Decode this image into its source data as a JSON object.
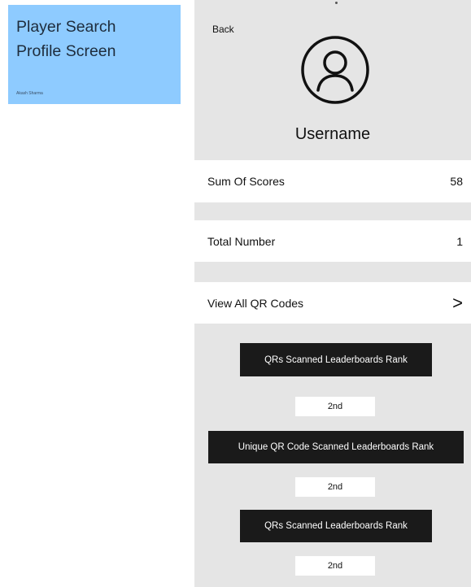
{
  "note": {
    "title": "Player Search\nProfile Screen",
    "author": "Akash Sharma"
  },
  "screen": {
    "back_label": "Back",
    "avatar_icon": "user-circle-icon",
    "username": "Username",
    "stats": [
      {
        "label": "Sum Of Scores",
        "value": "58"
      },
      {
        "label": "Total Number",
        "value": "1"
      }
    ],
    "view_all": {
      "label": "View All QR Codes",
      "chevron": ">"
    },
    "ranks": [
      {
        "label": "QRs Scanned Leaderboards Rank",
        "value": "2nd"
      },
      {
        "label": "Unique QR Code Scanned Leaderboards Rank",
        "value": "2nd"
      },
      {
        "label": "QRs Scanned Leaderboards Rank",
        "value": "2nd"
      }
    ]
  },
  "colors": {
    "note_bg": "#8ecbff",
    "screen_bg": "#e5e5e5",
    "button_bg": "#1a1a1a"
  }
}
